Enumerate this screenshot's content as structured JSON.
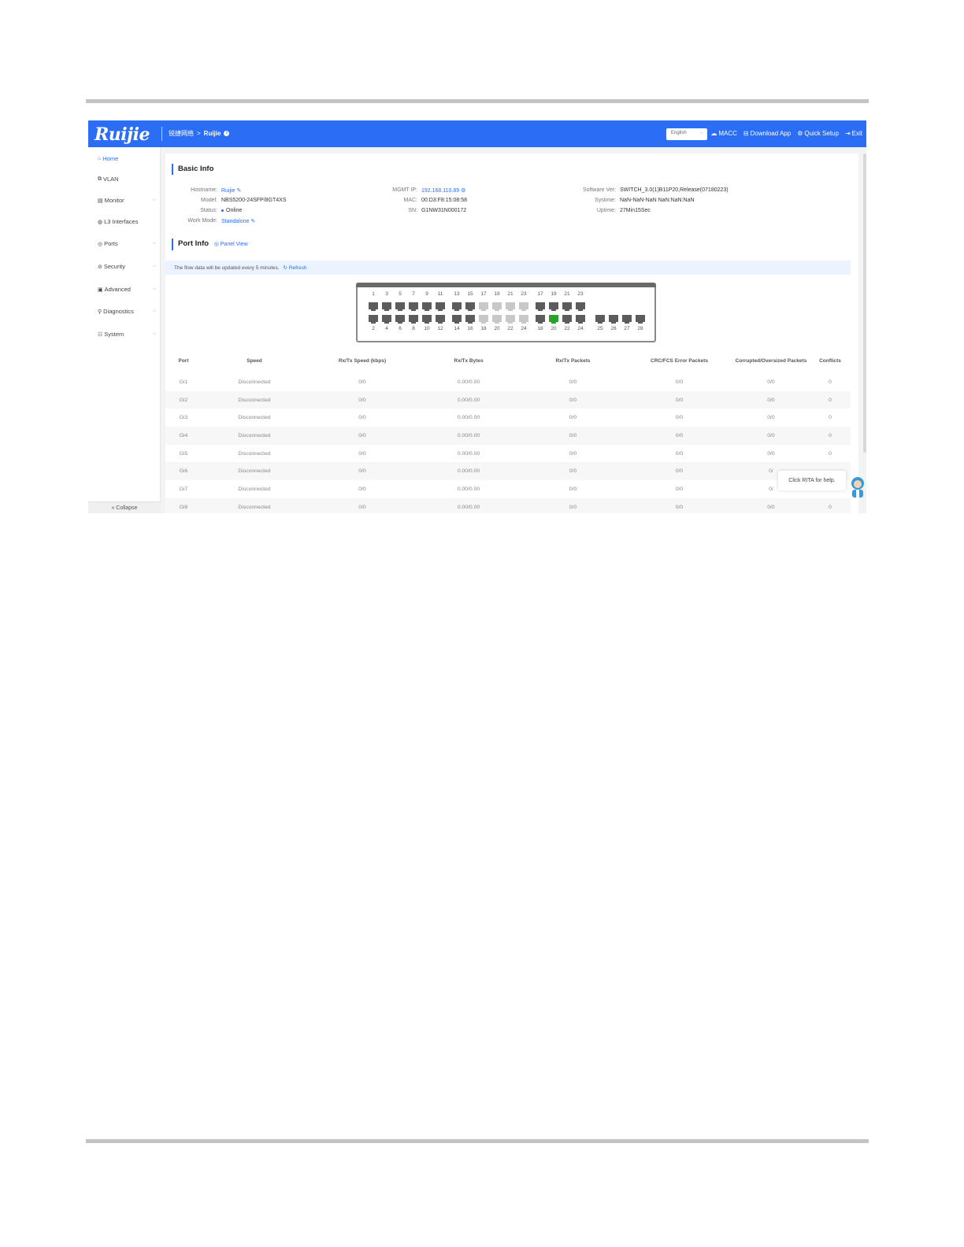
{
  "header": {
    "logo": "Ruijie",
    "breadcrumb": {
      "network": "锐捷网络",
      "separator": ">",
      "hostname": "Ruijie"
    },
    "language": "English",
    "links": [
      {
        "icon": "cloud-icon",
        "label": "MACC"
      },
      {
        "icon": "download-icon",
        "label": "Download App"
      },
      {
        "icon": "setup-icon",
        "label": "Quick Setup"
      },
      {
        "icon": "exit-icon",
        "label": "Exit"
      }
    ]
  },
  "sidebar": {
    "items": [
      {
        "icon": "home-icon",
        "label": "Home",
        "active": true,
        "expandable": false
      },
      {
        "icon": "vlan-icon",
        "label": "VLAN",
        "active": false,
        "expandable": false
      },
      {
        "icon": "monitor-icon",
        "label": "Monitor",
        "active": false,
        "expandable": true
      },
      {
        "icon": "l3-icon",
        "label": "L3 Interfaces",
        "active": false,
        "expandable": false
      },
      {
        "icon": "ports-icon",
        "label": "Ports",
        "active": false,
        "expandable": true
      },
      {
        "icon": "security-icon",
        "label": "Security",
        "active": false,
        "expandable": true
      },
      {
        "icon": "advanced-icon",
        "label": "Advanced",
        "active": false,
        "expandable": true
      },
      {
        "icon": "diagnostics-icon",
        "label": "Diagnostics",
        "active": false,
        "expandable": true
      },
      {
        "icon": "system-icon",
        "label": "System",
        "active": false,
        "expandable": true
      }
    ],
    "collapse": "« Collapse"
  },
  "basic_info": {
    "title": "Basic Info",
    "hostname_label": "Hostname:",
    "hostname": "Ruijie",
    "model_label": "Model:",
    "model": "NBS5200-24SFP/8GT4XS",
    "status_label": "Status:",
    "status": "Online",
    "workmode_label": "Work Mode:",
    "workmode": "Standalone",
    "mgmt_ip_label": "MGMT IP:",
    "mgmt_ip": "192.168.110.89",
    "mac_label": "MAC:",
    "mac": "00:D3:F8:15:08:58",
    "sn_label": "SN:",
    "sn": "G1NW31N000172",
    "software_label": "Software Ver:",
    "software": "SWITCH_3.0(1)B11P20,Release(07180223)",
    "systime_label": "Systime:",
    "systime": "NaN-NaN-NaN NaN:NaN:NaN",
    "uptime_label": "Uptime:",
    "uptime": "27Min15Sec"
  },
  "port_info": {
    "title": "Port Info",
    "panel_view": "Panel View",
    "notice": "The flow data will be updated every 5 minutes.",
    "refresh": "Refresh"
  },
  "panel_ports": {
    "top_numbers": [
      "1",
      "3",
      "5",
      "7",
      "9",
      "11",
      "13",
      "15",
      "17",
      "19",
      "21",
      "23",
      "17",
      "19",
      "21",
      "23"
    ],
    "bottom_numbers": [
      "2",
      "4",
      "6",
      "8",
      "10",
      "12",
      "14",
      "16",
      "18",
      "20",
      "22",
      "24",
      "18",
      "20",
      "22",
      "24",
      "25",
      "26",
      "27",
      "28"
    ],
    "top_states": [
      "on",
      "on",
      "on",
      "on",
      "on",
      "on",
      "on",
      "on",
      "off",
      "off",
      "off",
      "off",
      "on",
      "on",
      "on",
      "on"
    ],
    "bottom_states": [
      "on",
      "on",
      "on",
      "on",
      "on",
      "on",
      "on",
      "on",
      "off",
      "off",
      "off",
      "off",
      "on",
      "up",
      "on",
      "on",
      "on",
      "on",
      "on",
      "on"
    ]
  },
  "table": {
    "columns": [
      "Port",
      "Speed",
      "Rx/Tx Speed (kbps)",
      "Rx/Tx Bytes",
      "Rx/Tx Packets",
      "CRC/FCS Error Packets",
      "Corrupted/Oversized Packets",
      "Conflicts"
    ],
    "rows": [
      [
        "Gi1",
        "Disconnected",
        "0/0",
        "0.00/0.00",
        "0/0",
        "0/0",
        "0/0",
        "0"
      ],
      [
        "Gi2",
        "Disconnected",
        "0/0",
        "0.00/0.00",
        "0/0",
        "0/0",
        "0/0",
        "0"
      ],
      [
        "Gi3",
        "Disconnected",
        "0/0",
        "0.00/0.00",
        "0/0",
        "0/0",
        "0/0",
        "0"
      ],
      [
        "Gi4",
        "Disconnected",
        "0/0",
        "0.00/0.00",
        "0/0",
        "0/0",
        "0/0",
        "0"
      ],
      [
        "Gi5",
        "Disconnected",
        "0/0",
        "0.00/0.00",
        "0/0",
        "0/0",
        "0/0",
        "0"
      ],
      [
        "Gi6",
        "Disconnected",
        "0/0",
        "0.00/0.00",
        "0/0",
        "0/0",
        "0/",
        ""
      ],
      [
        "Gi7",
        "Disconnected",
        "0/0",
        "0.00/0.00",
        "0/0",
        "0/0",
        "0/",
        ""
      ],
      [
        "Gi8",
        "Disconnected",
        "0/0",
        "0.00/0.00",
        "0/0",
        "0/0",
        "0/0",
        "0"
      ]
    ]
  },
  "rita": {
    "tip": "Click RITA for help."
  },
  "colors": {
    "brand": "#2b6ef5",
    "port_on": "#5c5c5c",
    "port_off": "#c8c8c8",
    "port_up": "#2aa12a"
  }
}
